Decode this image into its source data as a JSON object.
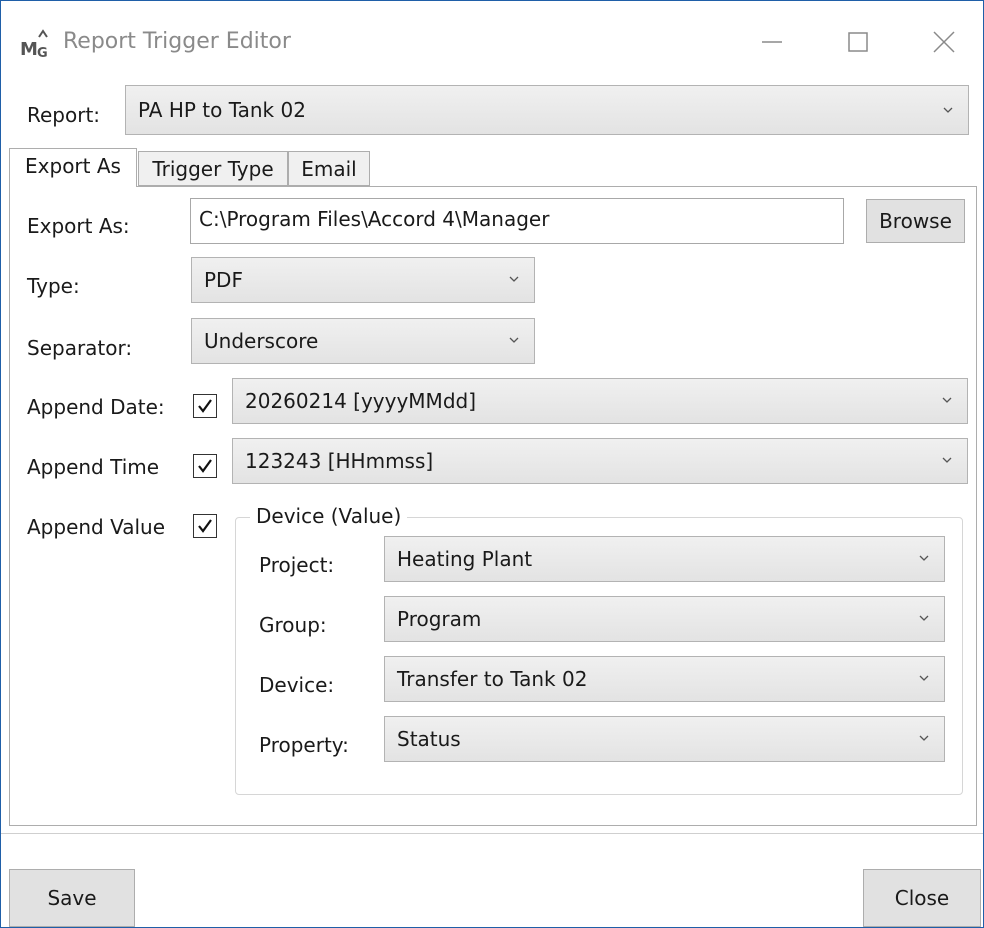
{
  "window": {
    "title": "Report Trigger Editor",
    "icon": "report-app-icon",
    "accent_color": "#1f5fa8"
  },
  "report": {
    "label": "Report:",
    "selected": "PA HP to Tank 02"
  },
  "tabs": [
    {
      "label": "Export As",
      "active": true
    },
    {
      "label": "Trigger Type",
      "active": false
    },
    {
      "label": "Email",
      "active": false
    }
  ],
  "export": {
    "path_label": "Export As:",
    "path_value": "C:\\Program Files\\Accord 4\\Manager",
    "browse_label": "Browse",
    "type_label": "Type:",
    "type_value": "PDF",
    "separator_label": "Separator:",
    "separator_value": "Underscore",
    "append_date_label": "Append Date:",
    "append_date_checked": true,
    "append_date_value": "20260214 [yyyyMMdd]",
    "append_time_label": "Append Time",
    "append_time_checked": true,
    "append_time_value": "123243 [HHmmss]",
    "append_value_label": "Append Value",
    "append_value_checked": true
  },
  "device_group": {
    "title": "Device (Value)",
    "project_label": "Project:",
    "project_value": "Heating Plant",
    "group_label": "Group:",
    "group_value": "Program",
    "device_label": "Device:",
    "device_value": "Transfer to Tank 02",
    "property_label": "Property:",
    "property_value": "Status"
  },
  "footer": {
    "save_label": "Save",
    "close_label": "Close"
  }
}
